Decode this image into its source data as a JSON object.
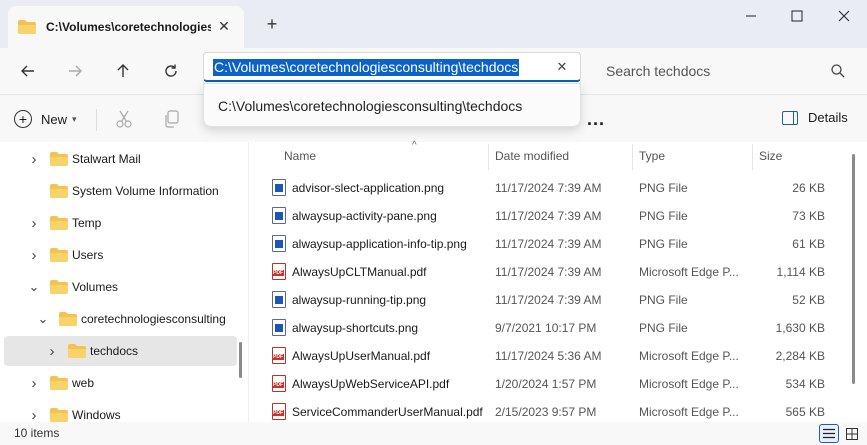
{
  "window": {
    "tab_title": "C:\\Volumes\\coretechnologiesconsulting\\techdocs",
    "new_tab": "+"
  },
  "address": {
    "value": "C:\\Volumes\\coretechnologiesconsulting\\techdocs",
    "suggestion": "C:\\Volumes\\coretechnologiesconsulting\\techdocs"
  },
  "search": {
    "placeholder": "Search techdocs"
  },
  "toolbar": {
    "new_label": "New",
    "more_label": "...",
    "details_label": "Details"
  },
  "nav": {
    "items": [
      {
        "label": "Stalwart Mail",
        "expandable": true
      },
      {
        "label": "System Volume Information",
        "expandable": false
      },
      {
        "label": "Temp",
        "expandable": true
      },
      {
        "label": "Users",
        "expandable": true
      },
      {
        "label": "Volumes",
        "expandable": true,
        "expanded": true
      },
      {
        "label": "coretechnologiesconsulting",
        "expandable": true,
        "expanded": true
      },
      {
        "label": "techdocs",
        "expandable": true,
        "selected": true
      },
      {
        "label": "web",
        "expandable": true
      },
      {
        "label": "Windows",
        "expandable": true
      }
    ]
  },
  "columns": {
    "name": "Name",
    "date": "Date modified",
    "type": "Type",
    "size": "Size"
  },
  "files": [
    {
      "name": "advisor-slect-application.png",
      "date": "11/17/2024 7:39 AM",
      "type": "PNG File",
      "size": "26 KB",
      "kind": "png"
    },
    {
      "name": "alwaysup-activity-pane.png",
      "date": "11/17/2024 7:39 AM",
      "type": "PNG File",
      "size": "73 KB",
      "kind": "png"
    },
    {
      "name": "alwaysup-application-info-tip.png",
      "date": "11/17/2024 7:39 AM",
      "type": "PNG File",
      "size": "61 KB",
      "kind": "png"
    },
    {
      "name": "AlwaysUpCLTManual.pdf",
      "date": "11/17/2024 7:39 AM",
      "type": "Microsoft Edge P...",
      "size": "1,114 KB",
      "kind": "pdf"
    },
    {
      "name": "alwaysup-running-tip.png",
      "date": "11/17/2024 7:39 AM",
      "type": "PNG File",
      "size": "52 KB",
      "kind": "png"
    },
    {
      "name": "alwaysup-shortcuts.png",
      "date": "9/7/2021 10:17 PM",
      "type": "PNG File",
      "size": "1,630 KB",
      "kind": "png"
    },
    {
      "name": "AlwaysUpUserManual.pdf",
      "date": "11/17/2024 5:36 AM",
      "type": "Microsoft Edge P...",
      "size": "2,284 KB",
      "kind": "pdf"
    },
    {
      "name": "AlwaysUpWebServiceAPI.pdf",
      "date": "1/20/2024 1:57 PM",
      "type": "Microsoft Edge P...",
      "size": "534 KB",
      "kind": "pdf"
    },
    {
      "name": "ServiceCommanderUserManual.pdf",
      "date": "2/15/2023 9:57 PM",
      "type": "Microsoft Edge P...",
      "size": "565 KB",
      "kind": "pdf"
    }
  ],
  "status": {
    "count": "10 items"
  },
  "colors": {
    "accent": "#0b63c9",
    "folder": "#f5c34b",
    "pdf": "#c6352d",
    "png": "#1e56b8"
  },
  "icons": [
    "folder-icon",
    "close-icon",
    "back-arrow-icon",
    "forward-arrow-icon",
    "up-arrow-icon",
    "refresh-icon",
    "search-icon",
    "cut-icon",
    "copy-icon",
    "details-pane-icon",
    "png-file-icon",
    "pdf-file-icon",
    "details-view-icon",
    "tiles-view-icon"
  ]
}
